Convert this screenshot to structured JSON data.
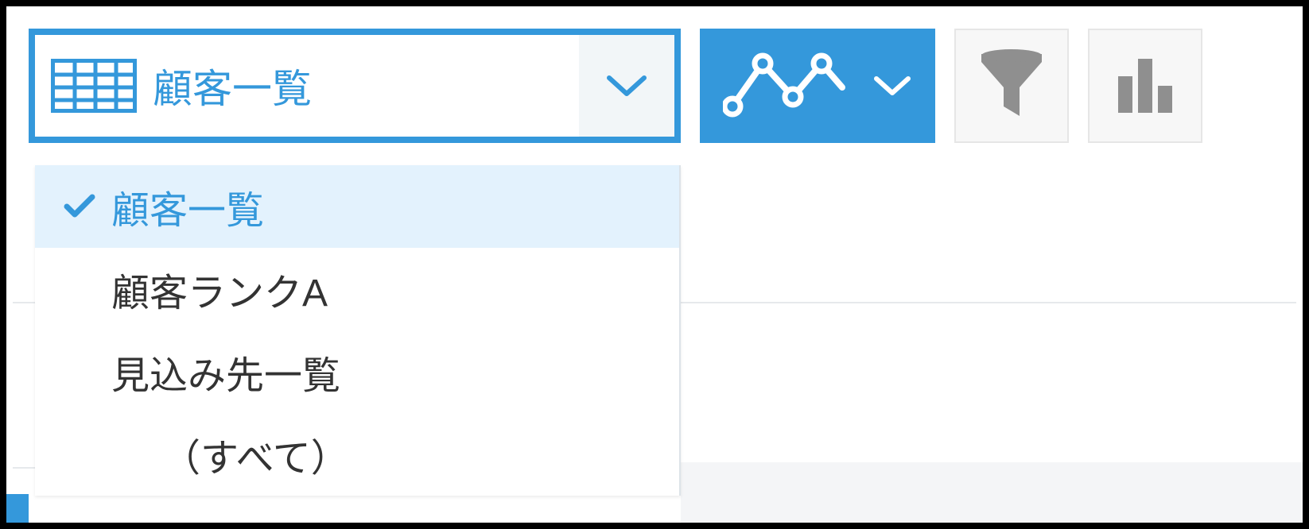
{
  "toolbar": {
    "viewSelector": {
      "label": "顧客一覧"
    },
    "dropdown": {
      "items": [
        {
          "label": "顧客一覧",
          "selected": true
        },
        {
          "label": "顧客ランクA",
          "selected": false
        },
        {
          "label": "見込み先一覧",
          "selected": false
        },
        {
          "label": "（すべて）",
          "selected": false
        }
      ]
    }
  }
}
